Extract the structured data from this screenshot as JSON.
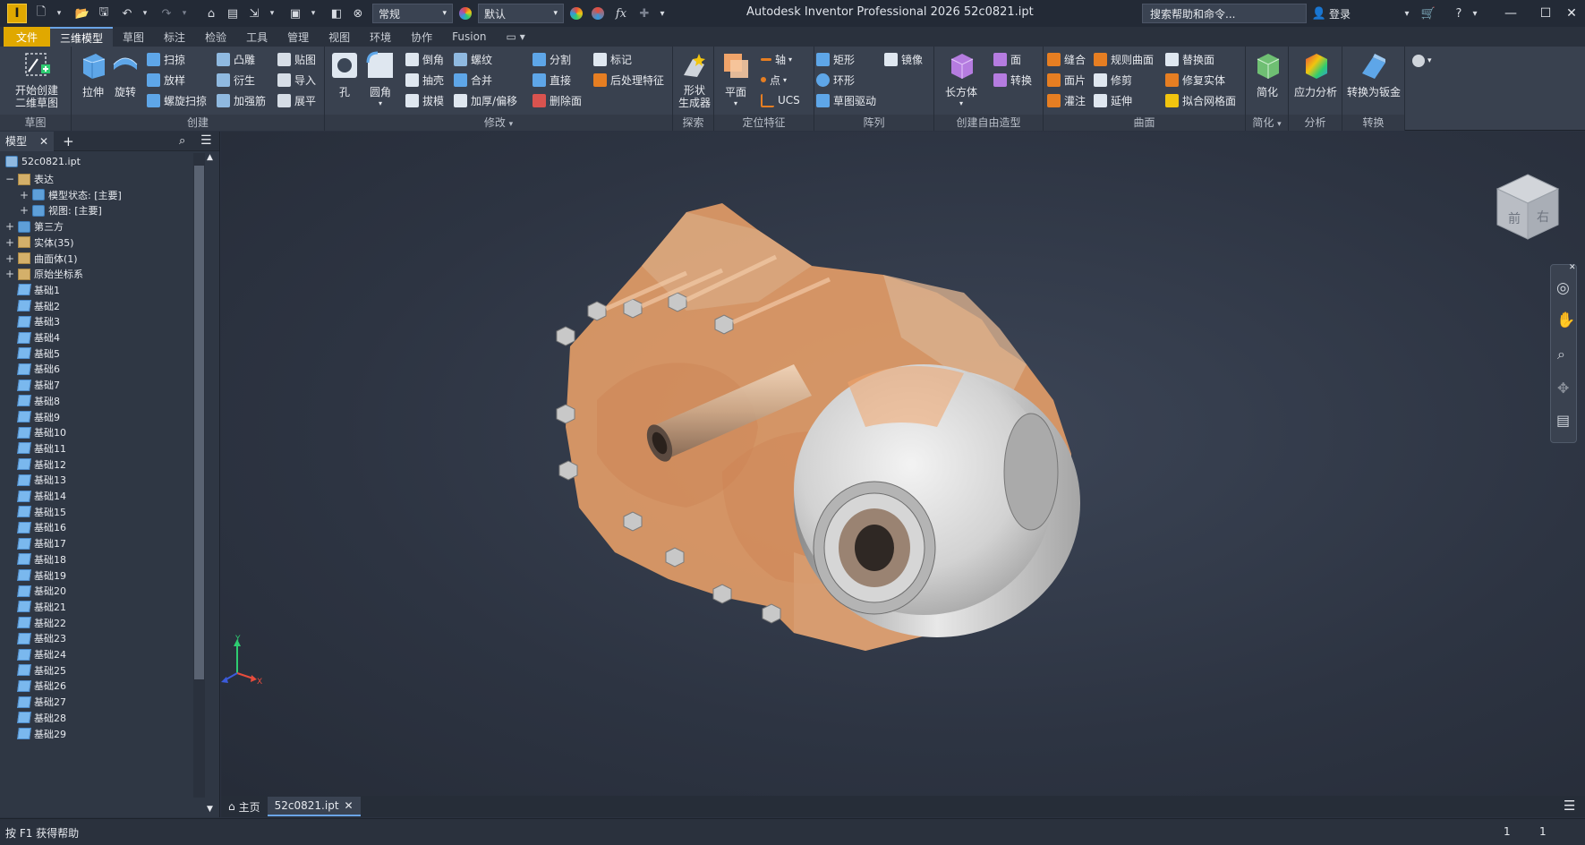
{
  "app": {
    "title": "Autodesk Inventor Professional 2026    52c0821.ipt",
    "logo_letter": "I",
    "search_placeholder": "搜索帮助和命令...",
    "login_label": "登录",
    "appearance_combo": "常规",
    "material_combo": "默认",
    "fx_label": "fx"
  },
  "menu_tabs": [
    "文件",
    "三维模型",
    "草图",
    "标注",
    "检验",
    "工具",
    "管理",
    "视图",
    "环境",
    "协作",
    "Fusion"
  ],
  "ribbon": {
    "sketch": {
      "label": "草图",
      "start_sketch": "开始创建\n二维草图"
    },
    "create": {
      "label": "创建",
      "extrude": "拉伸",
      "revolve": "旋转",
      "sweep": "扫掠",
      "loft": "放样",
      "coil": "螺旋扫掠",
      "emboss": "凸雕",
      "derive": "衍生",
      "rib": "加强筋",
      "decal": "贴图",
      "import": "导入",
      "unfold": "展平"
    },
    "modify": {
      "label": "修改",
      "hole": "孔",
      "fillet": "圆角",
      "chamfer": "倒角",
      "shell": "抽壳",
      "draft": "拔模",
      "thread": "螺纹",
      "combine": "合并",
      "thicken": "加厚/偏移",
      "split": "分割",
      "direct": "直接",
      "delete_face": "删除面",
      "mark": "标记",
      "post_process": "后处理特征"
    },
    "explore": {
      "label": "探索",
      "shape_generator": "形状\n生成器"
    },
    "work_features": {
      "label": "定位特征",
      "plane": "平面",
      "axis": "轴",
      "point": "点",
      "ucs": "UCS"
    },
    "pattern": {
      "label": "阵列",
      "rectangular": "矩形",
      "circular": "环形",
      "sketch_driven": "草图驱动",
      "mirror": "镜像"
    },
    "freeform": {
      "label": "创建自由造型",
      "box": "长方体",
      "face": "面",
      "convert": "转换"
    },
    "surface": {
      "label": "曲面",
      "stitch": "缝合",
      "ruled": "规则曲面",
      "replace": "替换面",
      "patch": "面片",
      "trim": "修剪",
      "repair": "修复实体",
      "sculpt": "灌注",
      "extend": "延伸",
      "fit_mesh": "拟合网格面"
    },
    "simplify": {
      "label": "简化",
      "simplify": "简化"
    },
    "analysis": {
      "label": "分析",
      "stress": "应力分析"
    },
    "convert": {
      "label": "转换",
      "sheet_metal": "转换为钣金"
    }
  },
  "browser": {
    "tab_label": "模型",
    "root": "52c0821.ipt",
    "items": [
      {
        "label": "表达",
        "expander": "−",
        "icon": "folder",
        "level": 1
      },
      {
        "label": "模型状态: [主要]",
        "expander": "+",
        "icon": "state",
        "level": 2
      },
      {
        "label": "视图: [主要]",
        "expander": "+",
        "icon": "view",
        "level": 2
      },
      {
        "label": "第三方",
        "expander": "+",
        "icon": "thirdparty",
        "level": 1
      },
      {
        "label": "实体(35)",
        "expander": "+",
        "icon": "folder",
        "level": 1
      },
      {
        "label": "曲面体(1)",
        "expander": "+",
        "icon": "folder",
        "level": 1
      },
      {
        "label": "原始坐标系",
        "expander": "+",
        "icon": "folder",
        "level": 1
      }
    ],
    "bases": [
      "基础1",
      "基础2",
      "基础3",
      "基础4",
      "基础5",
      "基础6",
      "基础7",
      "基础8",
      "基础9",
      "基础10",
      "基础11",
      "基础12",
      "基础13",
      "基础14",
      "基础15",
      "基础16",
      "基础17",
      "基础18",
      "基础19",
      "基础20",
      "基础21",
      "基础22",
      "基础23",
      "基础24",
      "基础25",
      "基础26",
      "基础27",
      "基础28",
      "基础29"
    ]
  },
  "viewcube": {
    "face_front": "前",
    "face_right": "右"
  },
  "doc_tabs": {
    "home": "主页",
    "active": "52c0821.ipt"
  },
  "status": {
    "help": "按 F1 获得帮助",
    "count1": "1",
    "count2": "1"
  },
  "colors": {
    "accent": "#e0a800",
    "model_orange": "#f0a46a",
    "disc_gray": "#d9d9d9"
  }
}
